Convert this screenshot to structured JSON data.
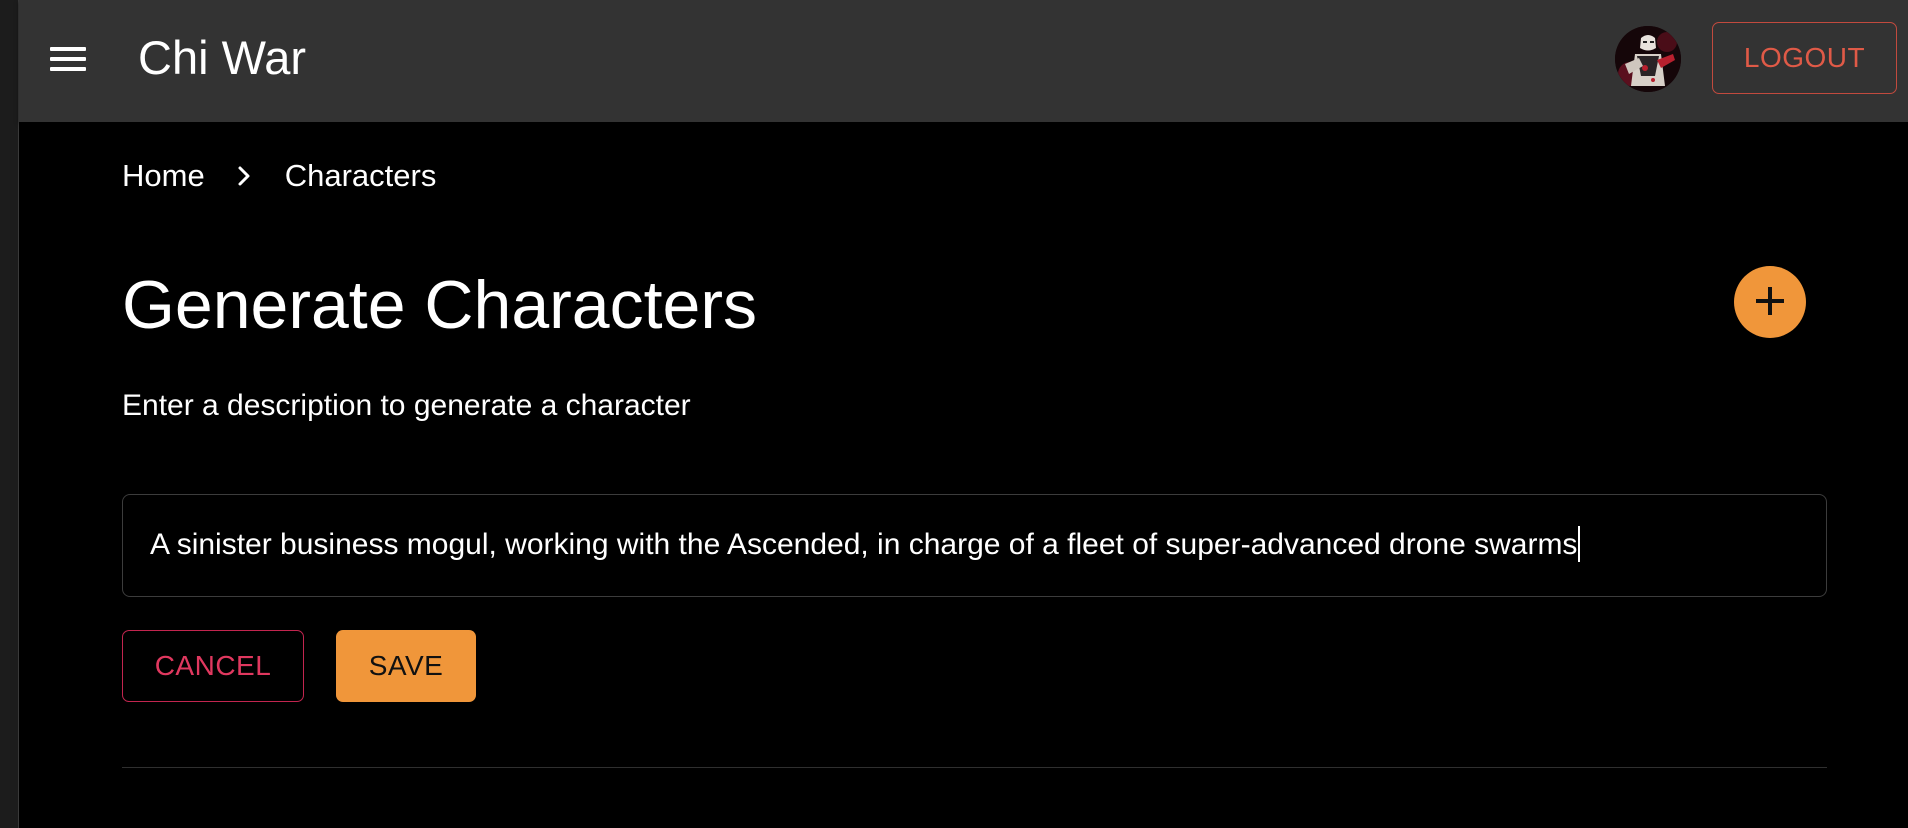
{
  "app": {
    "title": "Chi War",
    "menu_icon": "hamburger-menu-icon",
    "logout_label": "LOGOUT",
    "avatar_icon": "user-avatar"
  },
  "breadcrumb": {
    "items": [
      {
        "label": "Home"
      },
      {
        "label": "Characters"
      }
    ],
    "separator_icon": "chevron-right-icon"
  },
  "main": {
    "title": "Generate Characters",
    "add_icon": "plus-icon",
    "subtitle": "Enter a description to generate a character",
    "description_value": "A sinister business mogul, working with the Ascended, in charge of a fleet of super-advanced drone swarms",
    "cancel_label": "CANCEL",
    "save_label": "SAVE"
  },
  "colors": {
    "appbar_bg": "#333333",
    "page_bg": "#000000",
    "accent_orange": "#f0963a",
    "logout_red": "#e05a47",
    "cancel_pink": "#e0385f"
  }
}
